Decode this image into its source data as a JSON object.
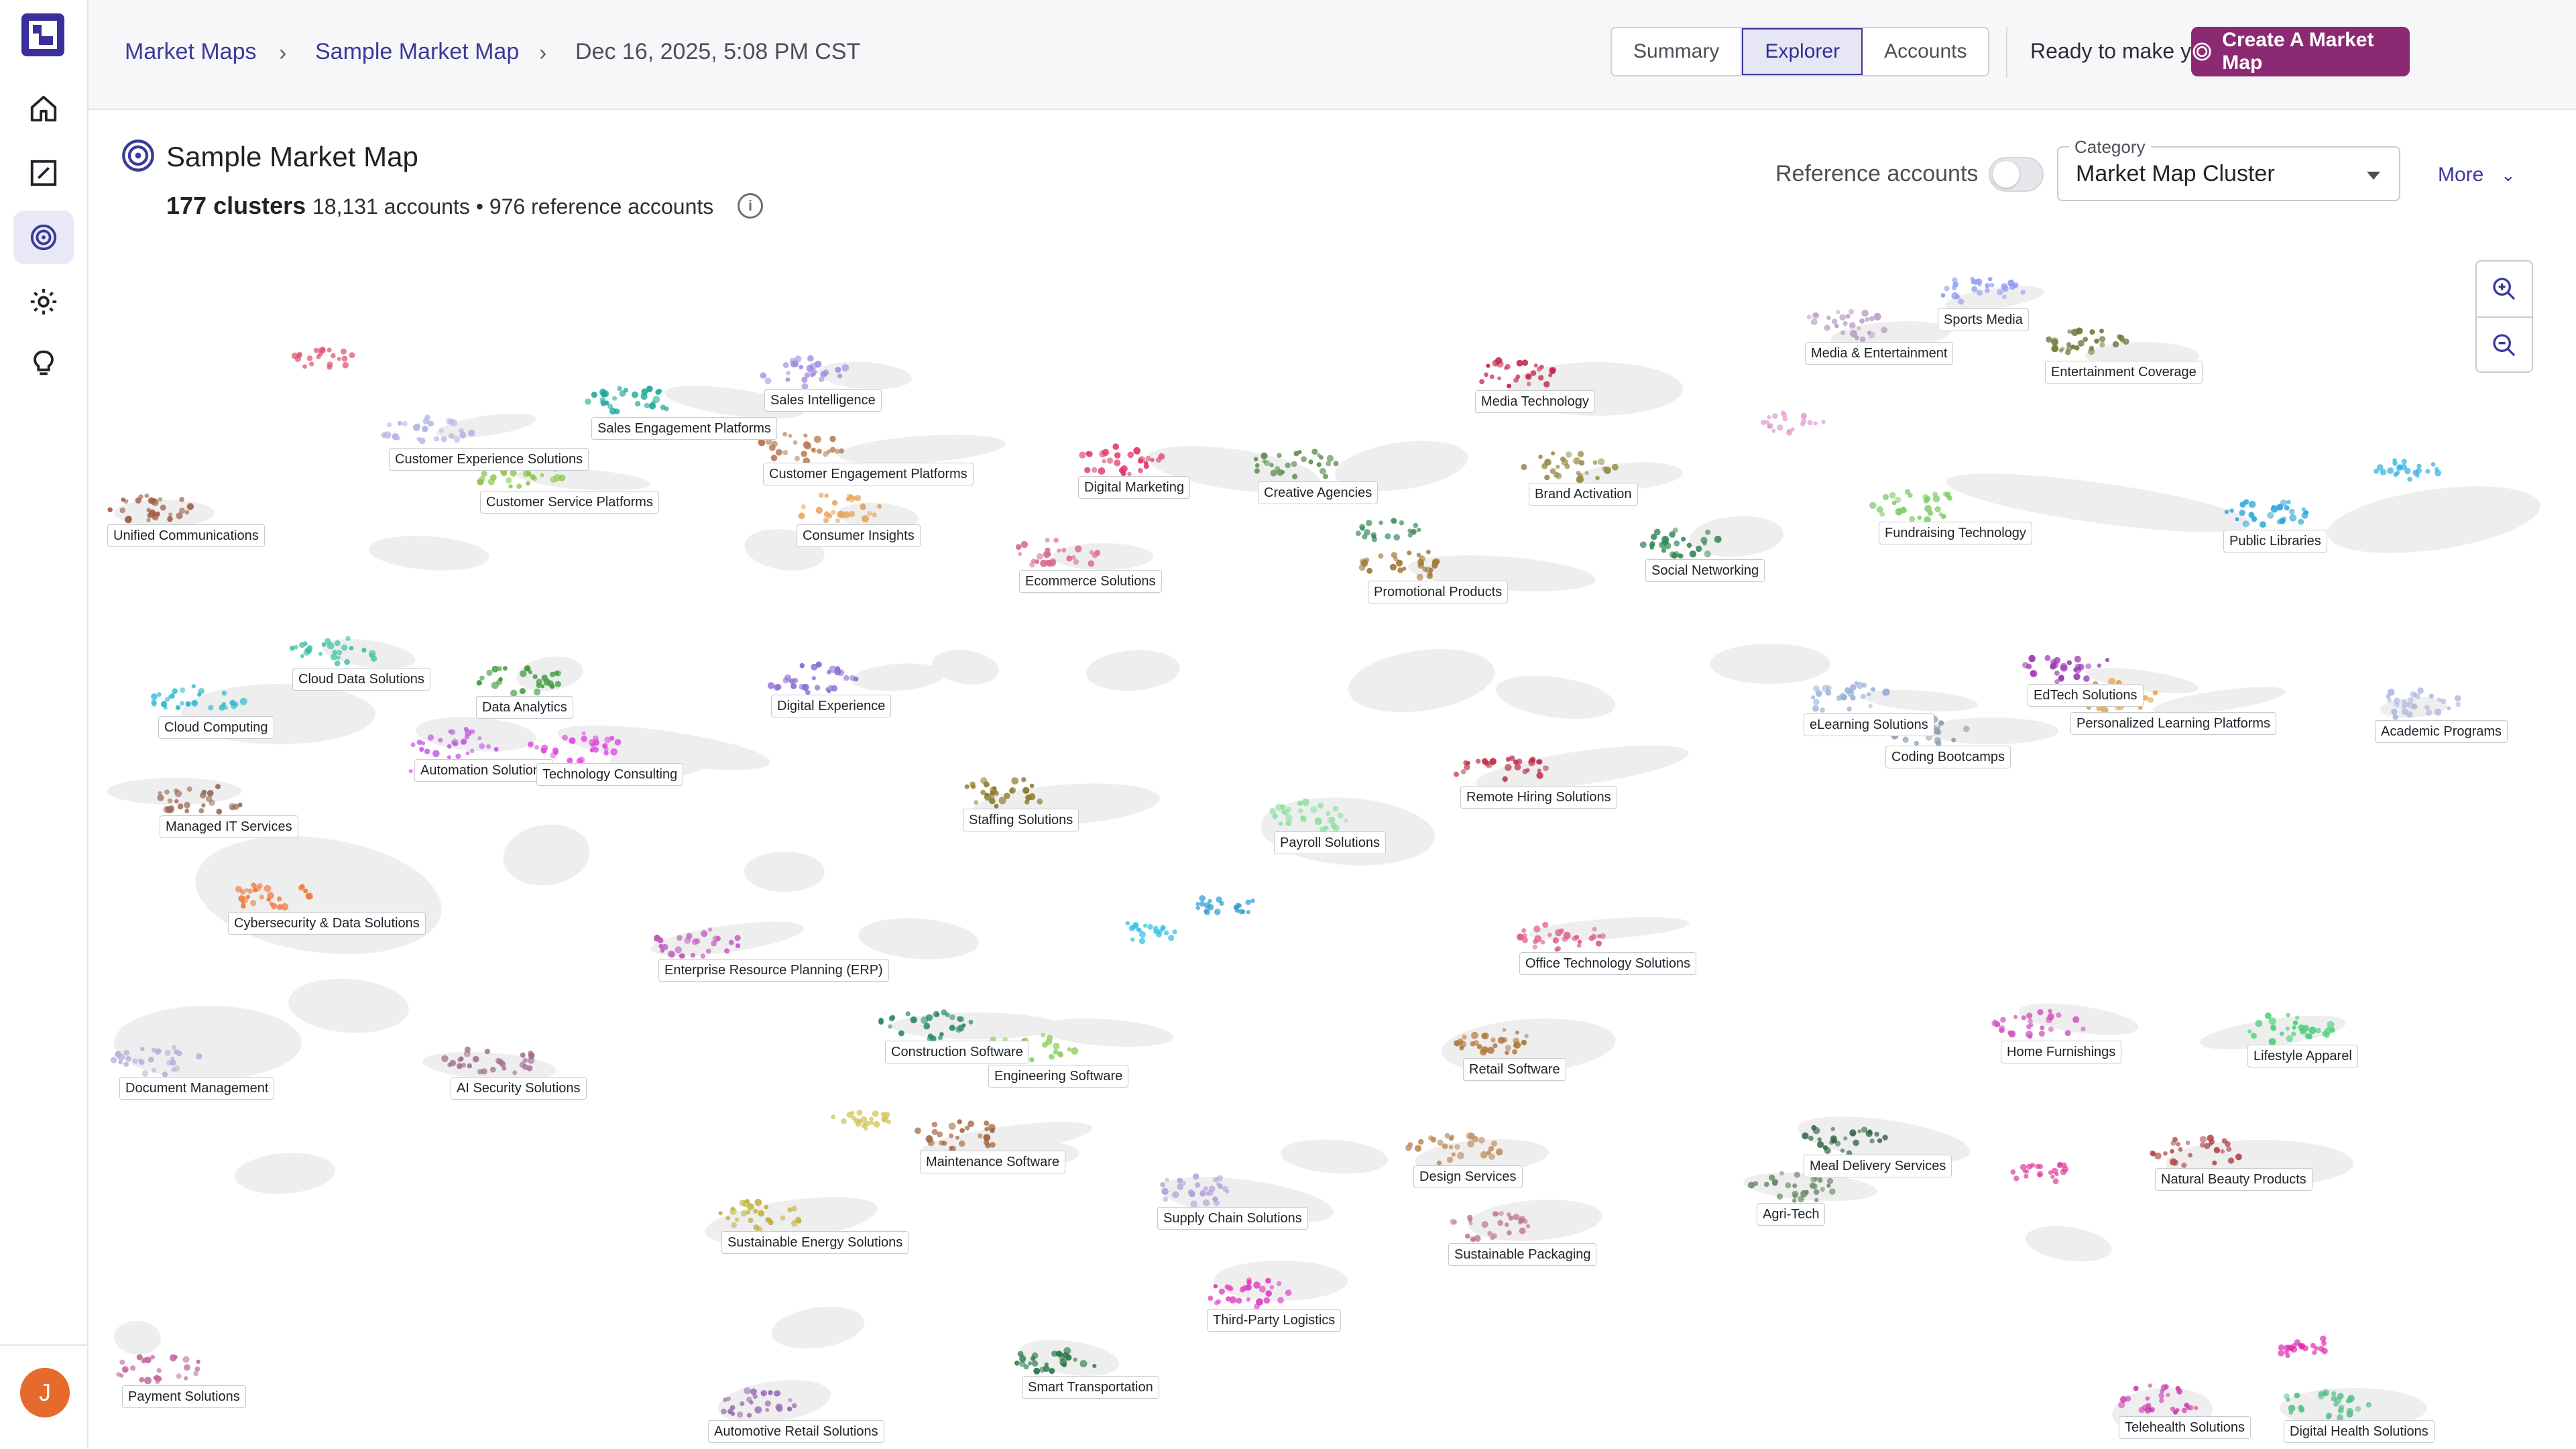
{
  "breadcrumb": {
    "root": "Market Maps",
    "map": "Sample Market Map",
    "timestamp": "Dec 16, 2025, 5:08 PM CST"
  },
  "view_tabs": [
    "Summary",
    "Explorer",
    "Accounts"
  ],
  "active_tab": "Explorer",
  "cta": {
    "prompt": "Ready to make your own?",
    "button": "Create A Market Map"
  },
  "header": {
    "title": "Sample Market Map",
    "clusters": "177 clusters",
    "accounts": "18,131 accounts • 976 reference accounts",
    "reference_toggle_label": "Reference accounts",
    "reference_toggle_on": false,
    "category_label": "Category",
    "category_value": "Market Map Cluster",
    "more_label": "More"
  },
  "user": {
    "initial": "J"
  },
  "icons": [
    "home-icon",
    "edit-icon",
    "market-map-icon",
    "gear-icon",
    "lightbulb-icon",
    "info-icon",
    "zoom-in-icon",
    "zoom-out-icon",
    "chevron-down-icon"
  ],
  "colors": {
    "brand": "#3b2f9c",
    "accent": "#3a3a9a",
    "cta": "#8b2a72",
    "avatar": "#e56a2c"
  },
  "clusters": [
    {
      "label": "Sports Media",
      "color": "#8f9bf2"
    },
    {
      "label": "Media & Entertainment",
      "color": "#b9a1c6"
    },
    {
      "label": "Entertainment Coverage",
      "color": "#6e7a3a"
    },
    {
      "label": "Sales Intelligence",
      "color": "#a08be0"
    },
    {
      "label": "Sales Engagement Platforms",
      "color": "#1fa79a"
    },
    {
      "label": "Customer Experience Solutions",
      "color": "#b5b5e6"
    },
    {
      "label": "Customer Engagement Platforms",
      "color": "#b77a52"
    },
    {
      "label": "Media Technology",
      "color": "#c2284d"
    },
    {
      "label": "Customer Service Platforms",
      "color": "#8ac44a"
    },
    {
      "label": "Digital Marketing",
      "color": "#e03a6a"
    },
    {
      "label": "Creative Agencies",
      "color": "#5a8a4a"
    },
    {
      "label": "Brand Activation",
      "color": "#9a8a4a"
    },
    {
      "label": "Unified Communications",
      "color": "#a0604a"
    },
    {
      "label": "Consumer Insights",
      "color": "#e8a45c"
    },
    {
      "label": "Fundraising Technology",
      "color": "#7fcf6a"
    },
    {
      "label": "Public Libraries",
      "color": "#2aa6d8"
    },
    {
      "label": "Social Networking",
      "color": "#3a8a5a"
    },
    {
      "label": "Ecommerce Solutions",
      "color": "#d86a8a"
    },
    {
      "label": "Promotional Products",
      "color": "#a0783a"
    },
    {
      "label": "Cloud Data Solutions",
      "color": "#3ac0a0"
    },
    {
      "label": "Data Analytics",
      "color": "#3a9a3a"
    },
    {
      "label": "Digital Experience",
      "color": "#8a6ad0"
    },
    {
      "label": "Cloud Computing",
      "color": "#2ab8d0"
    },
    {
      "label": "eLearning Solutions",
      "color": "#9ab0d8"
    },
    {
      "label": "EdTech Solutions",
      "color": "#9a3ab0"
    },
    {
      "label": "Personalized Learning Platforms",
      "color": "#e8a03a"
    },
    {
      "label": "Academic Programs",
      "color": "#b0b8e0"
    },
    {
      "label": "Coding Bootcamps",
      "color": "#8a9ab0"
    },
    {
      "label": "Automation Solutions",
      "color": "#c05ae0"
    },
    {
      "label": "Technology Consulting",
      "color": "#e04ae0"
    },
    {
      "label": "Remote Hiring Solutions",
      "color": "#c0304a"
    },
    {
      "label": "Staffing Solutions",
      "color": "#8a7a2a"
    },
    {
      "label": "Managed IT Services",
      "color": "#9a6a5a"
    },
    {
      "label": "Payroll Solutions",
      "color": "#8ae0a0"
    },
    {
      "label": "Cybersecurity & Data Solutions",
      "color": "#f07a3a"
    },
    {
      "label": "Enterprise Resource Planning (ERP)",
      "color": "#c05ac0"
    },
    {
      "label": "Office Technology Solutions",
      "color": "#e05a8a"
    },
    {
      "label": "Construction Software",
      "color": "#2a8a6a"
    },
    {
      "label": "Engineering Software",
      "color": "#8ad05a"
    },
    {
      "label": "Home Furnishings",
      "color": "#d05ac0"
    },
    {
      "label": "Lifestyle Apparel",
      "color": "#4ad07a"
    },
    {
      "label": "Retail Software",
      "color": "#b0783a"
    },
    {
      "label": "Document Management",
      "color": "#b0b0d8"
    },
    {
      "label": "AI Security Solutions",
      "color": "#a06a8a"
    },
    {
      "label": "Meal Delivery Services",
      "color": "#3a6a4a"
    },
    {
      "label": "Maintenance Software",
      "color": "#a0603a"
    },
    {
      "label": "Design Services",
      "color": "#c08a5a"
    },
    {
      "label": "Natural Beauty Products",
      "color": "#b04a4a"
    },
    {
      "label": "Agri-Tech",
      "color": "#6a8a6a"
    },
    {
      "label": "Supply Chain Solutions",
      "color": "#b0a0d8"
    },
    {
      "label": "Sustainable Energy Solutions",
      "color": "#c0b03a"
    },
    {
      "label": "Sustainable Packaging",
      "color": "#c07a8a"
    },
    {
      "label": "Third-Party Logistics",
      "color": "#e03ac0"
    },
    {
      "label": "Payment Solutions",
      "color": "#c06aa0"
    },
    {
      "label": "Smart Transportation",
      "color": "#2a7a4a"
    },
    {
      "label": "Automotive Retail Solutions",
      "color": "#9a6ab0"
    },
    {
      "label": "Telehealth Solutions",
      "color": "#d03ab0"
    },
    {
      "label": "Digital Health Solutions",
      "color": "#5ac08a"
    }
  ]
}
